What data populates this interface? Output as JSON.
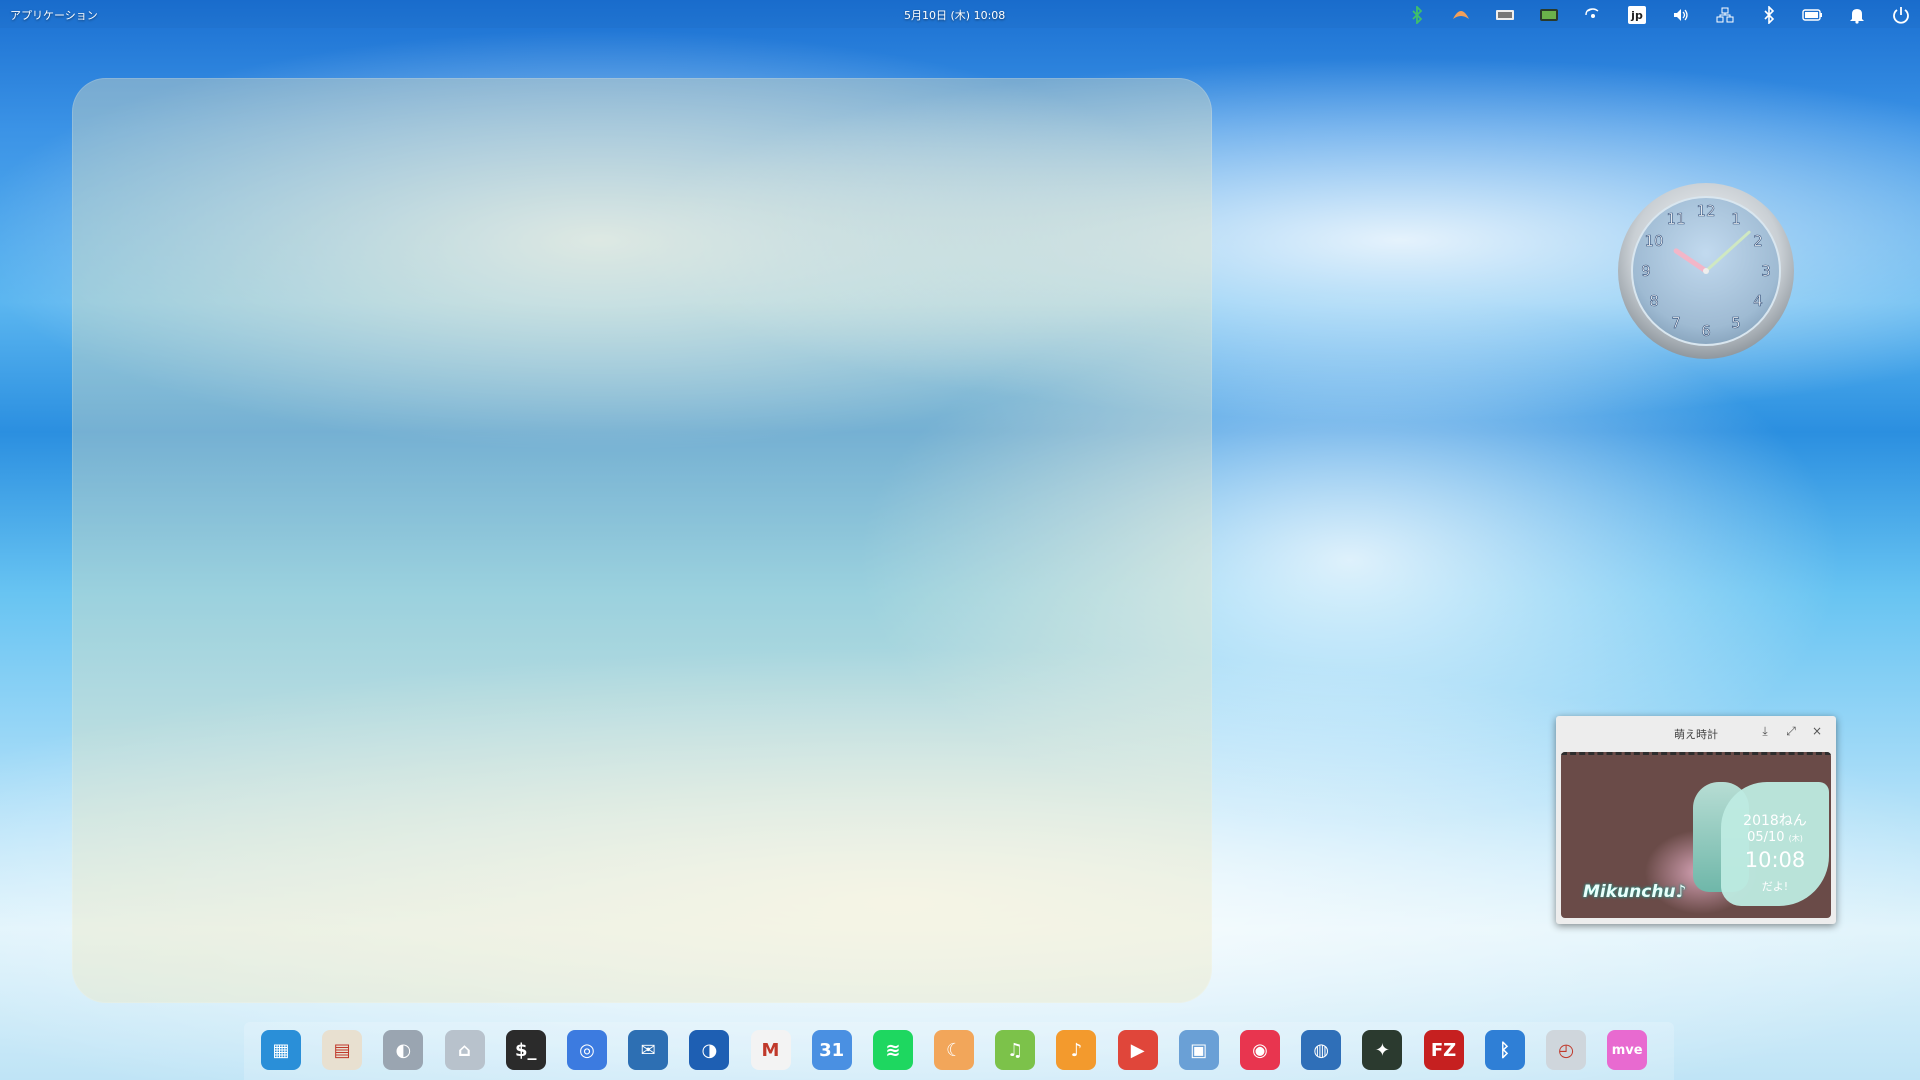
{
  "topbar": {
    "apps_label": "アプリケーション",
    "datetime": "5月10日 (木)  10:08",
    "keyboard_layout": "jp",
    "indicator_icons": [
      "bluetooth-alt-icon",
      "croissant-icon",
      "keyboard-icon",
      "screen-icon",
      "wireless-icon",
      "keyboard-layout-icon",
      "volume-icon",
      "network-icon",
      "bluetooth-icon",
      "battery-icon",
      "notification-bell-icon",
      "power-icon"
    ]
  },
  "analog_clock": {
    "numbers": [
      "12",
      "1",
      "2",
      "3",
      "4",
      "5",
      "6",
      "7",
      "8",
      "9",
      "10",
      "11"
    ],
    "hour": 10,
    "minute": 8
  },
  "widget": {
    "title": "萌え時計",
    "buttons": [
      "pin-icon",
      "expand-icon",
      "close-icon"
    ],
    "close_glyph": "×",
    "year_text": "2018ねん",
    "date_text": "05/10",
    "weekday_text": "(木)",
    "time_text": "10:08",
    "suffix_text": "だよ!",
    "brand_text": "Mikunchu♪"
  },
  "dock": {
    "items": [
      {
        "name": "multitasking-icon",
        "color": "#2a8fd8",
        "glyph": "▦"
      },
      {
        "name": "appcenter-icon",
        "color": "#e8e0d0",
        "glyph": "▤"
      },
      {
        "name": "settings-switch-icon",
        "color": "#9aa5b1",
        "glyph": "◐"
      },
      {
        "name": "files-icon",
        "color": "#b8c2cc",
        "glyph": "⌂"
      },
      {
        "name": "terminal-icon",
        "color": "#2b2b2b",
        "glyph": "$_"
      },
      {
        "name": "chromium-icon",
        "color": "#3c7be0",
        "glyph": "◎"
      },
      {
        "name": "thunderbird-icon",
        "color": "#2d6fb3",
        "glyph": "✉"
      },
      {
        "name": "seamonkey-icon",
        "color": "#1e5fb3",
        "glyph": "◑"
      },
      {
        "name": "gmail-icon",
        "color": "#f3f3f3",
        "glyph": "M"
      },
      {
        "name": "calendar-icon",
        "color": "#4a90e2",
        "glyph": "31"
      },
      {
        "name": "spotify-icon",
        "color": "#1ed760",
        "glyph": "≋"
      },
      {
        "name": "croissant-icon",
        "color": "#f2a65a",
        "glyph": "☾"
      },
      {
        "name": "music-mixer-icon",
        "color": "#7cc24a",
        "glyph": "♫"
      },
      {
        "name": "music-icon",
        "color": "#f39a2d",
        "glyph": "♪"
      },
      {
        "name": "video-player-icon",
        "color": "#e0463a",
        "glyph": "▶"
      },
      {
        "name": "screenshot-icon",
        "color": "#6aa0d6",
        "glyph": "▣"
      },
      {
        "name": "lips-app-icon",
        "color": "#e8354f",
        "glyph": "◉"
      },
      {
        "name": "globe-feather-icon",
        "color": "#2f6fb8",
        "glyph": "◍"
      },
      {
        "name": "ninja-app-icon",
        "color": "#2b3a2f",
        "glyph": "✦"
      },
      {
        "name": "filezilla-icon",
        "color": "#c62020",
        "glyph": "FZ"
      },
      {
        "name": "bluetooth-icon",
        "color": "#2f7fd6",
        "glyph": "ᛒ"
      },
      {
        "name": "clock-app-icon",
        "color": "#cfd6dc",
        "glyph": "◴"
      },
      {
        "name": "mve-tokei-icon",
        "color": "#e86ad0",
        "glyph": "mve"
      }
    ]
  },
  "colors": {
    "glass": "#eee8be",
    "accent": "#2a8fd8",
    "widget_teal": "#bfeee3"
  }
}
